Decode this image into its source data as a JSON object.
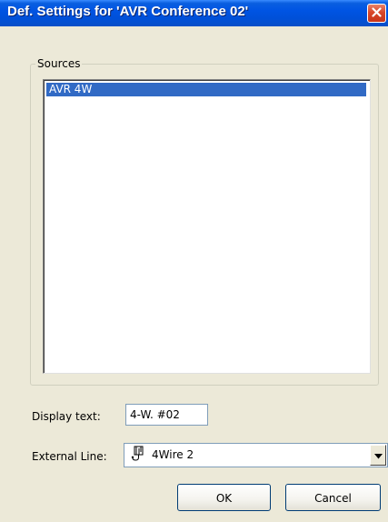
{
  "window": {
    "title": "Def. Settings for 'AVR Conference 02'",
    "close_icon": "close-icon"
  },
  "sources": {
    "group_label": "Sources",
    "items": [
      {
        "label": "AVR 4W",
        "selected": true
      }
    ]
  },
  "display_text": {
    "label": "Display text:",
    "value": "4-W. #02"
  },
  "external_line": {
    "label": "External Line:",
    "value": "4Wire 2",
    "icon": "phone-line-icon"
  },
  "buttons": {
    "ok_label": "OK",
    "cancel_label": "Cancel"
  },
  "colors": {
    "titlebar": "#0054E3",
    "selection": "#316AC5",
    "close_button": "#D9482A",
    "dialog_bg": "#ECE9D8"
  }
}
